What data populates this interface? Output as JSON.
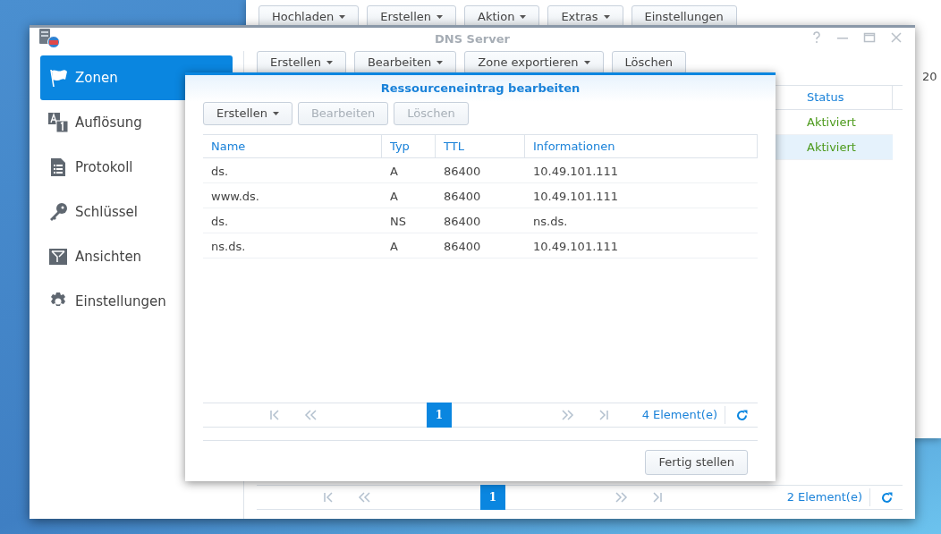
{
  "background_window": {
    "toolbar": [
      {
        "label": "Hochladen",
        "dropdown": true
      },
      {
        "label": "Erstellen",
        "dropdown": true
      },
      {
        "label": "Aktion",
        "dropdown": true
      },
      {
        "label": "Extras",
        "dropdown": true
      },
      {
        "label": "Einstellungen",
        "dropdown": false
      }
    ],
    "cell_text": "20"
  },
  "window": {
    "title": "DNS Server",
    "sidebar": {
      "items": [
        {
          "label": "Zonen",
          "selected": true
        },
        {
          "label": "Auflösung",
          "selected": false
        },
        {
          "label": "Protokoll",
          "selected": false
        },
        {
          "label": "Schlüssel",
          "selected": false
        },
        {
          "label": "Ansichten",
          "selected": false
        },
        {
          "label": "Einstellungen",
          "selected": false
        }
      ]
    },
    "toolbar": [
      {
        "label": "Erstellen",
        "dropdown": true
      },
      {
        "label": "Bearbeiten",
        "dropdown": true
      },
      {
        "label": "Zone exportieren",
        "dropdown": true
      },
      {
        "label": "Löschen",
        "dropdown": false
      }
    ],
    "table": {
      "columns": [
        "Status"
      ],
      "rows": [
        {
          "status": "Aktiviert",
          "selected": false
        },
        {
          "status": "Aktiviert",
          "selected": true
        }
      ]
    },
    "pagination": {
      "page": "1",
      "count": "2 Element(e)"
    }
  },
  "dialog": {
    "title": "Ressourceneintrag bearbeiten",
    "toolbar": [
      {
        "label": "Erstellen",
        "dropdown": true,
        "disabled": false
      },
      {
        "label": "Bearbeiten",
        "dropdown": false,
        "disabled": true
      },
      {
        "label": "Löschen",
        "dropdown": false,
        "disabled": true
      }
    ],
    "table": {
      "columns": [
        "Name",
        "Typ",
        "TTL",
        "Informationen"
      ],
      "rows": [
        [
          "ds.",
          "A",
          "86400",
          "10.49.101.111"
        ],
        [
          "www.ds.",
          "A",
          "86400",
          "10.49.101.111"
        ],
        [
          "ds.",
          "NS",
          "86400",
          "ns.ds."
        ],
        [
          "ns.ds.",
          "A",
          "86400",
          "10.49.101.111"
        ]
      ]
    },
    "pagination": {
      "page": "1",
      "count": "4 Element(e)"
    },
    "buttons": [
      "Fertig stellen"
    ]
  }
}
